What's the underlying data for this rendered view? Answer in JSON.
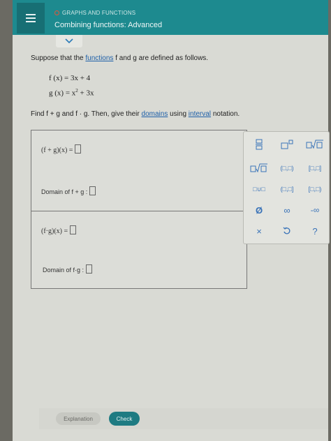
{
  "header": {
    "kicker": "GRAPHS AND FUNCTIONS",
    "title": "Combining functions: Advanced"
  },
  "problem": {
    "prompt_before": "Suppose that the ",
    "prompt_link": "functions",
    "prompt_after": " f and g are defined as follows.",
    "eq_f": "f (x) = 3x + 4",
    "eq_g_base": "g (x) = x",
    "eq_g_exp": "2",
    "eq_g_tail": " + 3x",
    "find_before": "Find f + g and f · g. Then, give their ",
    "find_link1": "domains",
    "find_mid": " using ",
    "find_link2": "interval",
    "find_after": " notation."
  },
  "answers": {
    "sum_expr": "(f + g)(x) =",
    "sum_domain": "Domain of f + g :",
    "prod_expr": "(f·g)(x) =",
    "prod_domain": "Domain of f·g :"
  },
  "palette": {
    "buttons": [
      "fraction-button",
      "exponent-button",
      "sqrt-button",
      "nth-root-button",
      "open-interval-button",
      "closed-interval-button",
      "union-button",
      "half-open-left-button",
      "half-open-right-button",
      "empty-set-button",
      "infinity-button",
      "neg-infinity-button",
      "clear-button",
      "undo-button",
      "help-button"
    ],
    "interval_open": "(□,□)",
    "interval_closed": "[□,□]",
    "interval_half_right": "(□,□]",
    "interval_half_left": "[□,□)",
    "union": "□∪□",
    "empty_set": "Ø",
    "infinity": "∞",
    "neg_infinity": "-∞",
    "clear": "×",
    "help": "?"
  },
  "footer": {
    "explanation": "Explanation",
    "check": "Check"
  },
  "colors": {
    "header": "#1d8a8f",
    "link": "#1d5fa8",
    "check": "#1e7b82"
  }
}
